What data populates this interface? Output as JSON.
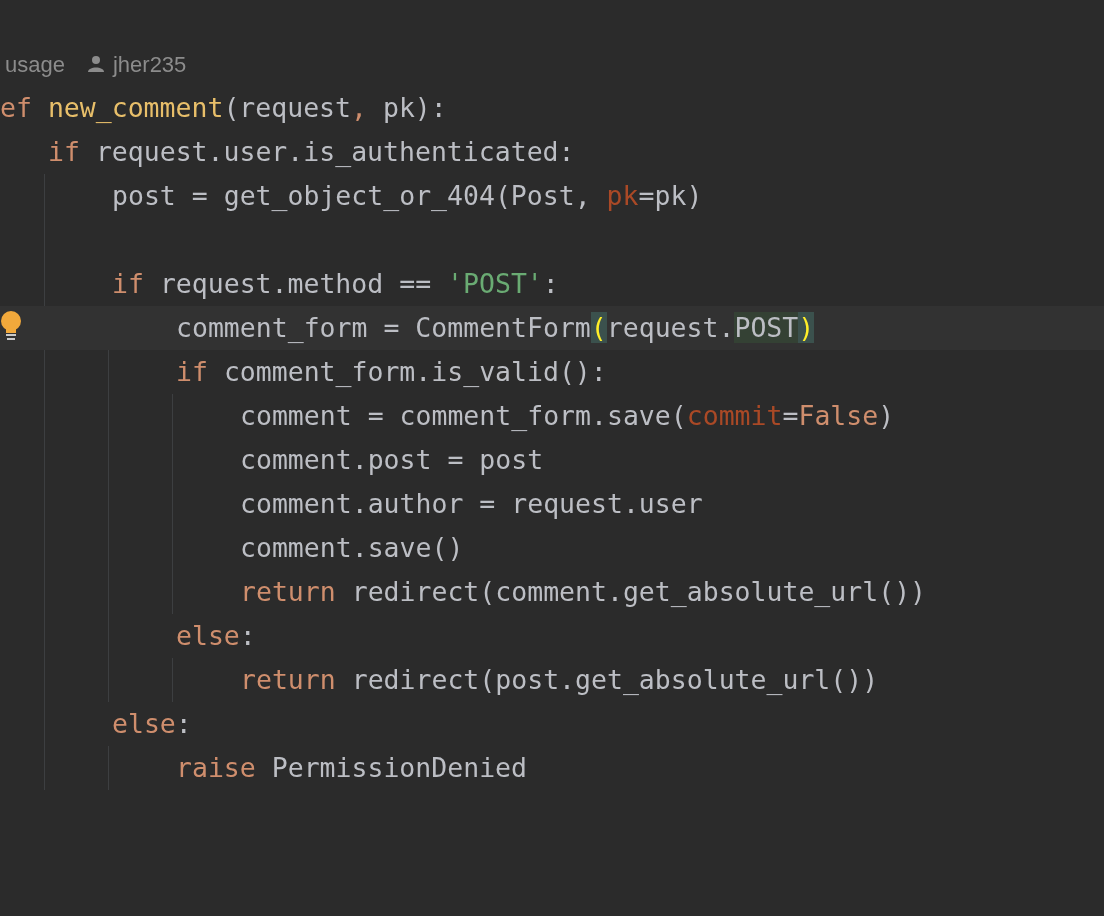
{
  "usage_line": {
    "usages": "usage",
    "author": "jher235"
  },
  "lines": [
    {
      "kind": "code",
      "current": false,
      "tokens": [
        {
          "text": "ef",
          "kind": "keyword"
        },
        {
          "text": "new_comment",
          "kind": "function",
          "space_before": true
        },
        {
          "text": "(request",
          "kind": "plain"
        },
        {
          "text": ",",
          "kind": "keyword"
        },
        {
          "text": "pk):",
          "kind": "plain",
          "space_before": true
        }
      ],
      "children": [
        {
          "kind": "code",
          "current": false,
          "tokens": [
            {
              "text": "if",
              "kind": "keyword"
            },
            {
              "text": "request.user.is_authenticated:",
              "kind": "plain",
              "space_before": true
            }
          ],
          "children": [
            {
              "kind": "code",
              "current": false,
              "tokens": [
                {
                  "text": "post = get_object_or_404(Post,",
                  "kind": "plain"
                },
                {
                  "text": "pk",
                  "kind": "param",
                  "space_before": true
                },
                {
                  "text": "=pk)",
                  "kind": "plain"
                }
              ]
            },
            {
              "kind": "blank"
            },
            {
              "kind": "code",
              "current": false,
              "tokens": [
                {
                  "text": "if",
                  "kind": "keyword"
                },
                {
                  "text": "request.method ==",
                  "kind": "plain",
                  "space_before": true
                },
                {
                  "text": "'POST'",
                  "kind": "string",
                  "space_before": true
                },
                {
                  "text": ":",
                  "kind": "plain"
                }
              ],
              "children": [
                {
                  "kind": "code",
                  "current": true,
                  "tokens": [
                    {
                      "text": "comment_form = CommentForm",
                      "kind": "plain"
                    },
                    {
                      "text": "(",
                      "kind": "brace"
                    },
                    {
                      "text": "request.",
                      "kind": "plain"
                    },
                    {
                      "text": "POST",
                      "kind": "match"
                    },
                    {
                      "text": ")",
                      "kind": "brace"
                    }
                  ]
                },
                {
                  "kind": "code",
                  "current": false,
                  "tokens": [
                    {
                      "text": "if",
                      "kind": "keyword"
                    },
                    {
                      "text": "comment_form.is_valid():",
                      "kind": "plain",
                      "space_before": true
                    }
                  ],
                  "children": [
                    {
                      "kind": "code",
                      "current": false,
                      "tokens": [
                        {
                          "text": "comment = comment_form.save(",
                          "kind": "plain"
                        },
                        {
                          "text": "commit",
                          "kind": "param"
                        },
                        {
                          "text": "=",
                          "kind": "plain"
                        },
                        {
                          "text": "False",
                          "kind": "keyword"
                        },
                        {
                          "text": ")",
                          "kind": "plain"
                        }
                      ]
                    },
                    {
                      "kind": "code",
                      "current": false,
                      "tokens": [
                        {
                          "text": "comment.post = post",
                          "kind": "plain"
                        }
                      ]
                    },
                    {
                      "kind": "code",
                      "current": false,
                      "tokens": [
                        {
                          "text": "comment.author = request.user",
                          "kind": "plain"
                        }
                      ]
                    },
                    {
                      "kind": "code",
                      "current": false,
                      "tokens": [
                        {
                          "text": "comment.save()",
                          "kind": "plain"
                        }
                      ]
                    },
                    {
                      "kind": "code",
                      "current": false,
                      "tokens": [
                        {
                          "text": "return",
                          "kind": "keyword"
                        },
                        {
                          "text": "redirect(comment.get_absolute_url())",
                          "kind": "plain",
                          "space_before": true
                        }
                      ]
                    }
                  ]
                },
                {
                  "kind": "code",
                  "current": false,
                  "tokens": [
                    {
                      "text": "else",
                      "kind": "keyword"
                    },
                    {
                      "text": ":",
                      "kind": "plain"
                    }
                  ],
                  "children": [
                    {
                      "kind": "code",
                      "current": false,
                      "tokens": [
                        {
                          "text": "return",
                          "kind": "keyword"
                        },
                        {
                          "text": "redirect(post.get_absolute_url())",
                          "kind": "plain",
                          "space_before": true
                        }
                      ]
                    }
                  ]
                }
              ]
            },
            {
              "kind": "code",
              "current": false,
              "tokens": [
                {
                  "text": "else",
                  "kind": "keyword"
                },
                {
                  "text": ":",
                  "kind": "plain"
                }
              ],
              "children": [
                {
                  "kind": "code",
                  "current": false,
                  "tokens": [
                    {
                      "text": "raise",
                      "kind": "keyword"
                    },
                    {
                      "text": "PermissionDenied",
                      "kind": "plain",
                      "space_before": true
                    }
                  ]
                }
              ]
            }
          ]
        }
      ]
    }
  ]
}
